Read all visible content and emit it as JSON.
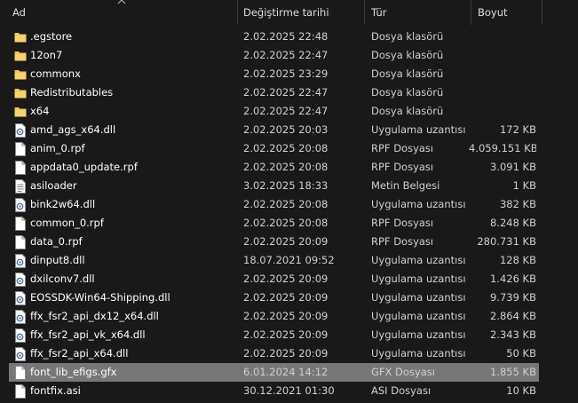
{
  "columns": {
    "name": "Ad",
    "date": "Değiştirme tarihi",
    "type": "Tür",
    "size": "Boyut"
  },
  "colors": {
    "folder": "#f2c54b",
    "selected_row": "#777777",
    "background": "#191919"
  },
  "files": [
    {
      "name": ".egstore",
      "date": "2.02.2025 22:48",
      "type": "Dosya klasörü",
      "size": "",
      "icon": "folder-icon"
    },
    {
      "name": "12on7",
      "date": "2.02.2025 22:47",
      "type": "Dosya klasörü",
      "size": "",
      "icon": "folder-icon"
    },
    {
      "name": "commonx",
      "date": "2.02.2025 23:29",
      "type": "Dosya klasörü",
      "size": "",
      "icon": "folder-icon"
    },
    {
      "name": "Redistributables",
      "date": "2.02.2025 22:47",
      "type": "Dosya klasörü",
      "size": "",
      "icon": "folder-icon"
    },
    {
      "name": "x64",
      "date": "2.02.2025 22:47",
      "type": "Dosya klasörü",
      "size": "",
      "icon": "folder-icon"
    },
    {
      "name": "amd_ags_x64.dll",
      "date": "2.02.2025 20:03",
      "type": "Uygulama uzantısı",
      "size": "172 KB",
      "icon": "dll-icon"
    },
    {
      "name": "anim_0.rpf",
      "date": "2.02.2025 20:08",
      "type": "RPF Dosyası",
      "size": "4.059.151 KB",
      "icon": "file-icon"
    },
    {
      "name": "appdata0_update.rpf",
      "date": "2.02.2025 20:08",
      "type": "RPF Dosyası",
      "size": "3.091 KB",
      "icon": "file-icon"
    },
    {
      "name": "asiloader",
      "date": "3.02.2025 18:33",
      "type": "Metin Belgesi",
      "size": "1 KB",
      "icon": "text-file-icon"
    },
    {
      "name": "bink2w64.dll",
      "date": "2.02.2025 20:08",
      "type": "Uygulama uzantısı",
      "size": "382 KB",
      "icon": "dll-icon"
    },
    {
      "name": "common_0.rpf",
      "date": "2.02.2025 20:08",
      "type": "RPF Dosyası",
      "size": "8.248 KB",
      "icon": "file-icon"
    },
    {
      "name": "data_0.rpf",
      "date": "2.02.2025 20:09",
      "type": "RPF Dosyası",
      "size": "280.731 KB",
      "icon": "file-icon"
    },
    {
      "name": "dinput8.dll",
      "date": "18.07.2021 09:52",
      "type": "Uygulama uzantısı",
      "size": "128 KB",
      "icon": "dll-icon"
    },
    {
      "name": "dxilconv7.dll",
      "date": "2.02.2025 20:09",
      "type": "Uygulama uzantısı",
      "size": "1.426 KB",
      "icon": "dll-icon"
    },
    {
      "name": "EOSSDK-Win64-Shipping.dll",
      "date": "2.02.2025 20:09",
      "type": "Uygulama uzantısı",
      "size": "9.739 KB",
      "icon": "dll-icon"
    },
    {
      "name": "ffx_fsr2_api_dx12_x64.dll",
      "date": "2.02.2025 20:09",
      "type": "Uygulama uzantısı",
      "size": "2.864 KB",
      "icon": "dll-icon"
    },
    {
      "name": "ffx_fsr2_api_vk_x64.dll",
      "date": "2.02.2025 20:09",
      "type": "Uygulama uzantısı",
      "size": "2.343 KB",
      "icon": "dll-icon"
    },
    {
      "name": "ffx_fsr2_api_x64.dll",
      "date": "2.02.2025 20:09",
      "type": "Uygulama uzantısı",
      "size": "50 KB",
      "icon": "dll-icon"
    },
    {
      "name": "font_lib_efigs.gfx",
      "date": "6.01.2024 14:12",
      "type": "GFX Dosyası",
      "size": "1.855 KB",
      "icon": "file-icon",
      "selected": true
    },
    {
      "name": "fontfix.asi",
      "date": "30.12.2021 01:30",
      "type": "ASI Dosyası",
      "size": "10 KB",
      "icon": "file-icon"
    }
  ]
}
